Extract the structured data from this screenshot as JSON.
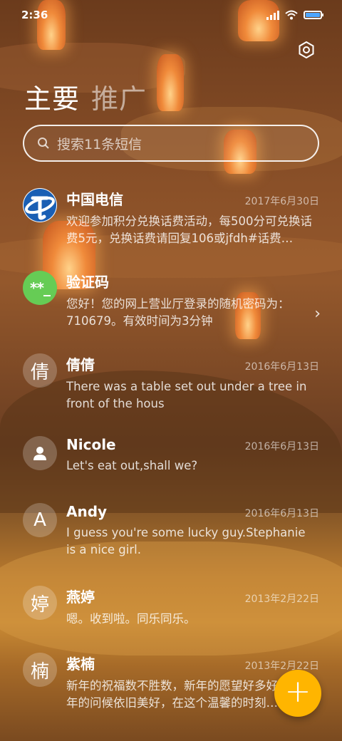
{
  "status": {
    "time": "2:36"
  },
  "tabs": [
    {
      "label": "主要"
    },
    {
      "label": "推广"
    }
  ],
  "search": {
    "placeholder": "搜索11条短信"
  },
  "messages": [
    {
      "name": "中国电信",
      "date": "2017年6月30日",
      "preview": "欢迎参加积分兑换话费活动，每500分可兑换话费5元，兑换话费请回复106或jfdh#话费…",
      "avatar_text": ""
    },
    {
      "name": "验证码",
      "date": "",
      "preview": "您好！您的网上营业厅登录的随机密码为：710679。有效时间为3分钟",
      "avatar_text": "**_"
    },
    {
      "name": "倩倩",
      "date": "2016年6月13日",
      "preview": "There was a table set out under a tree in front of the hous",
      "avatar_text": "倩"
    },
    {
      "name": "Nicole",
      "date": "2016年6月13日",
      "preview": "Let's eat out,shall we?",
      "avatar_text": ""
    },
    {
      "name": "Andy",
      "date": "2016年6月13日",
      "preview": "I guess you're some lucky guy.Stephanie is a nice girl.",
      "avatar_text": "A"
    },
    {
      "name": "燕婷",
      "date": "2013年2月22日",
      "preview": "嗯。收到啦。同乐同乐。",
      "avatar_text": "婷"
    },
    {
      "name": "紫楠",
      "date": "2013年2月22日",
      "preview": "新年的祝福数不胜数，新年的愿望好多好多，新年的问候依旧美好，在这个温馨的时刻…",
      "avatar_text": "楠"
    }
  ],
  "fab": {
    "label": "+"
  },
  "colors": {
    "accent": "#ffb500",
    "code_avatar": "#66cc55",
    "telecom_blue": "#1a5fb4"
  }
}
